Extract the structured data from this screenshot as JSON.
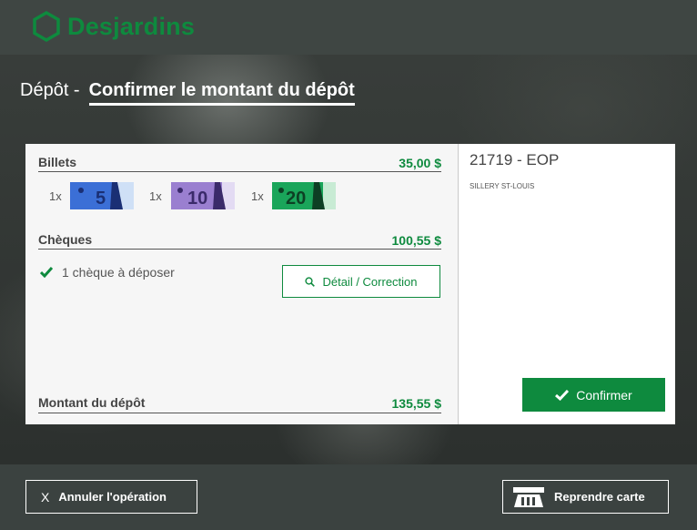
{
  "brand": {
    "name": "Desjardins",
    "color": "#0e8a3e",
    "icon": "hexagon-logo-icon"
  },
  "title": {
    "prefix": "Dépôt -",
    "main": "Confirmer le montant du dépôt"
  },
  "deposit": {
    "bills": {
      "label": "Billets",
      "amount": "35,00 $",
      "items": [
        {
          "qty": "1x",
          "denomination": "5",
          "color": "#3b6fd6"
        },
        {
          "qty": "1x",
          "denomination": "10",
          "color": "#9a7fd0"
        },
        {
          "qty": "1x",
          "denomination": "20",
          "color": "#1aa55a"
        }
      ]
    },
    "cheques": {
      "label": "Chèques",
      "amount": "100,55 $",
      "status": "1 chèque à déposer",
      "detail_button": "Détail / Correction"
    },
    "total": {
      "label": "Montant du dépôt",
      "amount": "135,55 $"
    }
  },
  "account": {
    "id": "21719 - EOP",
    "name": "SILLERY ST-LOUIS"
  },
  "actions": {
    "confirm": "Confirmer",
    "cancel_icon": "X",
    "cancel": "Annuler l'opération",
    "return_card": "Reprendre carte"
  }
}
